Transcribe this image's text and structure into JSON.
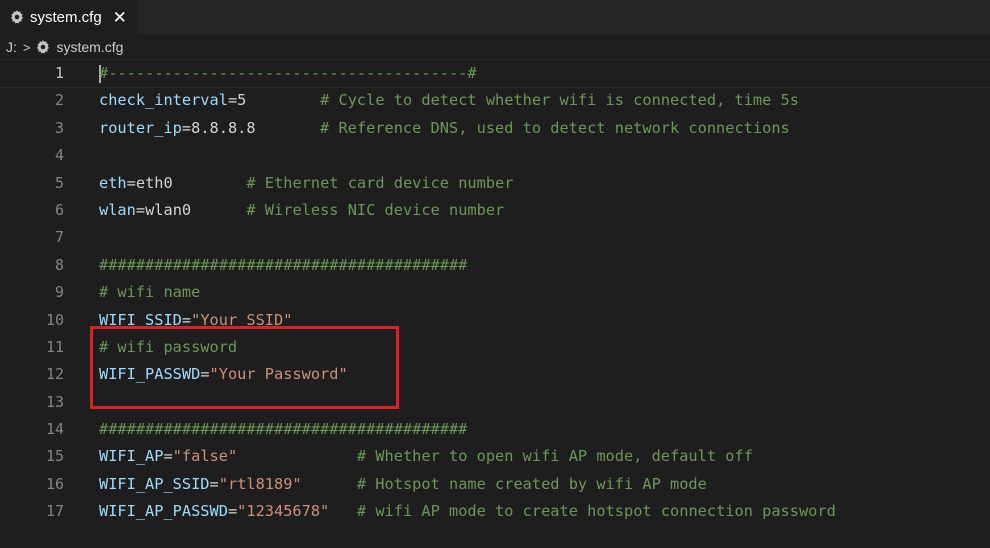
{
  "tab": {
    "filename": "system.cfg",
    "icon": "gear-icon",
    "close_glyph": "✕"
  },
  "breadcrumb": {
    "drive": "J:",
    "separator": ">",
    "file": "system.cfg"
  },
  "editor": {
    "active_line": 1,
    "lines": [
      {
        "n": "1",
        "key": "#---------------------------------------#",
        "sep": "",
        "val": "",
        "comment": "",
        "type": "comment_rule"
      },
      {
        "n": "2",
        "key": "check_interval",
        "sep": "=",
        "val": "5",
        "pad": "        ",
        "comment": "# Cycle to detect whether wifi is connected, time 5s"
      },
      {
        "n": "3",
        "key": "router_ip",
        "sep": "=",
        "val": "8.8.8.8",
        "pad": "       ",
        "comment": "# Reference DNS, used to detect network connections"
      },
      {
        "n": "4"
      },
      {
        "n": "5",
        "key": "eth",
        "sep": "=",
        "val": "eth0",
        "pad": "        ",
        "comment": "# Ethernet card device number"
      },
      {
        "n": "6",
        "key": "wlan",
        "sep": "=",
        "val": "wlan0",
        "pad": "      ",
        "comment": "# Wireless NIC device number"
      },
      {
        "n": "7"
      },
      {
        "n": "8",
        "comment": "########################################"
      },
      {
        "n": "9",
        "comment": "# wifi name"
      },
      {
        "n": "10",
        "key": "WIFI_SSID",
        "sep": "=",
        "str": "\"Your SSID\""
      },
      {
        "n": "11",
        "comment": "# wifi password"
      },
      {
        "n": "12",
        "key": "WIFI_PASSWD",
        "sep": "=",
        "str": "\"Your Password\""
      },
      {
        "n": "13"
      },
      {
        "n": "14",
        "comment": "########################################"
      },
      {
        "n": "15",
        "key": "WIFI_AP",
        "sep": "=",
        "str": "\"false\"",
        "pad": "             ",
        "comment": "# Whether to open wifi AP mode, default off"
      },
      {
        "n": "16",
        "key": "WIFI_AP_SSID",
        "sep": "=",
        "str": "\"rtl8189\"",
        "pad": "      ",
        "comment": "# Hotspot name created by wifi AP mode"
      },
      {
        "n": "17",
        "key": "WIFI_AP_PASSWD",
        "sep": "=",
        "str": "\"12345678\"",
        "pad": "   ",
        "comment": "# wifi AP mode to create hotspot connection password"
      }
    ]
  },
  "colors": {
    "background": "#1e1e1e",
    "tabbar": "#252526",
    "key": "#9cdcfe",
    "string": "#ce9178",
    "comment": "#6a9955",
    "line_number": "#858585",
    "highlight_border": "#e02020"
  }
}
